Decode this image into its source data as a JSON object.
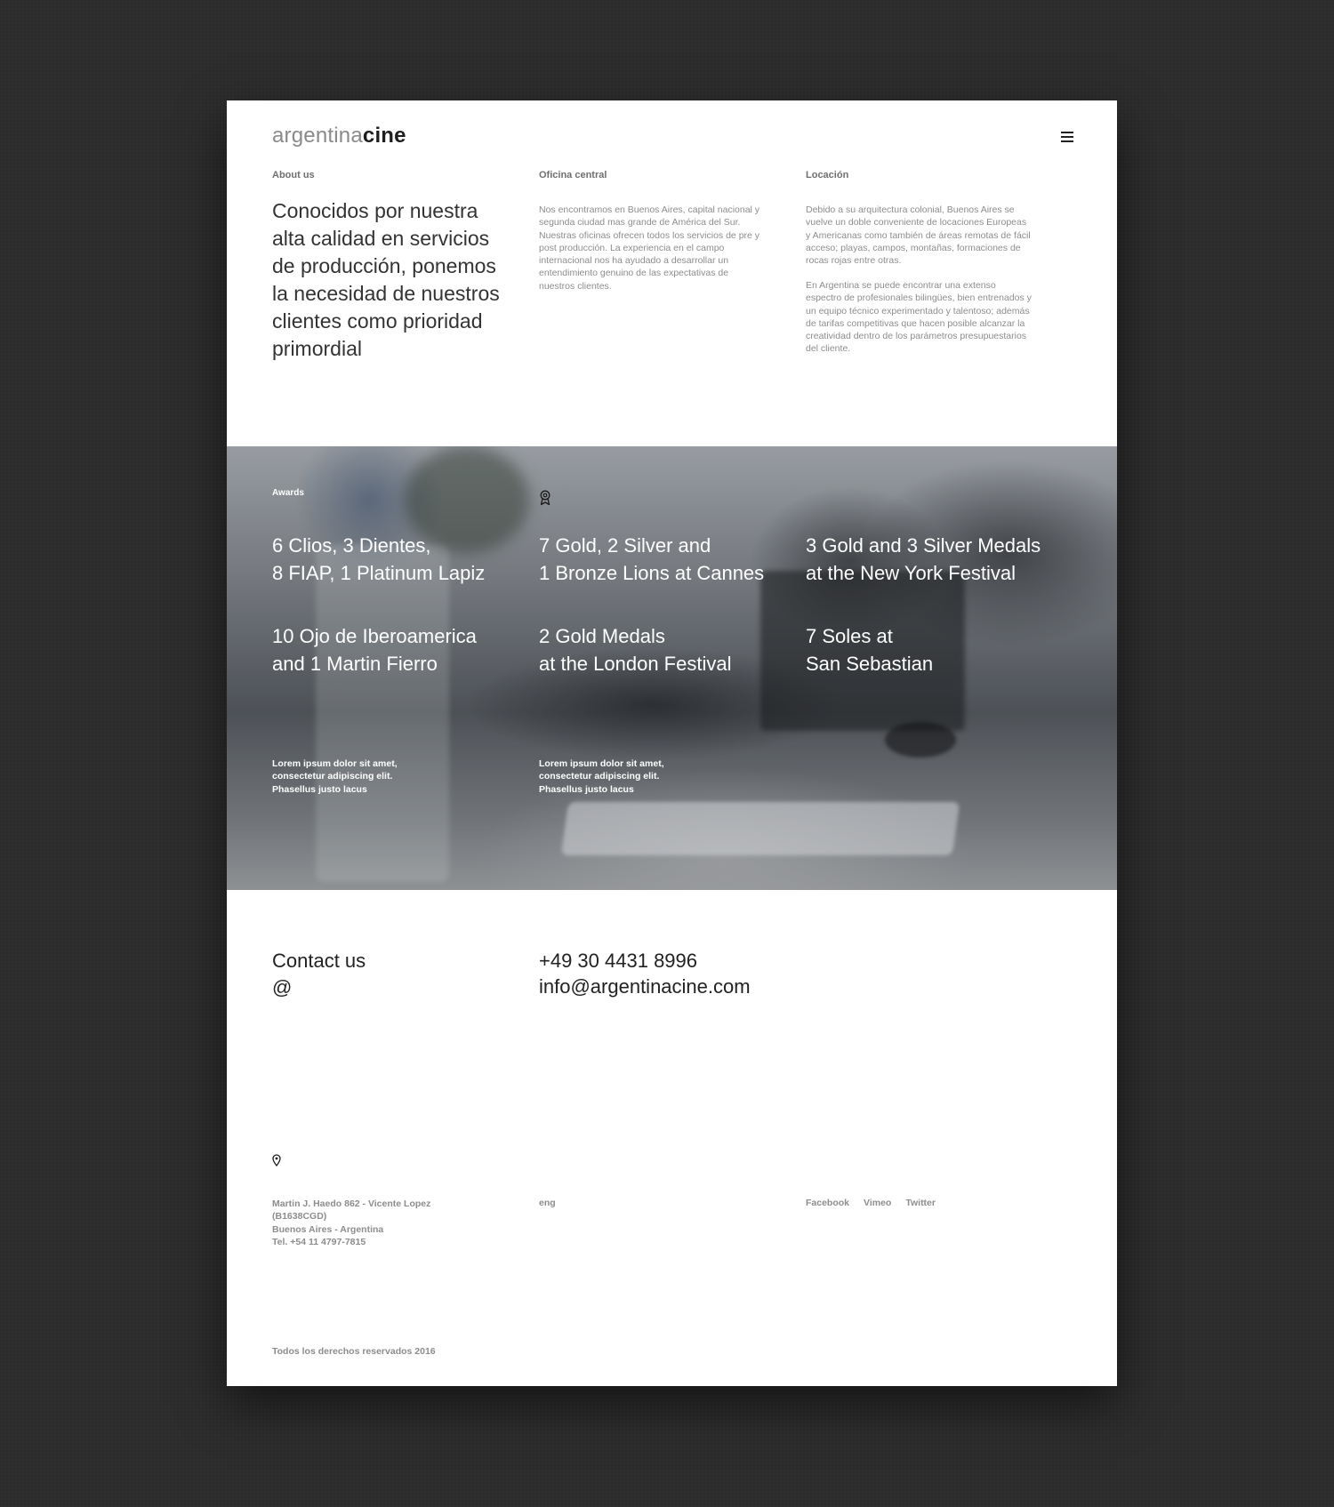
{
  "header": {
    "logo_light": "argentina",
    "logo_bold": "cine",
    "menu_icon": "hamburger-menu-icon"
  },
  "about": {
    "label": "About us",
    "text": "Conocidos por nuestra alta calidad en servicios de producción, ponemos la necesidad de nuestros clientes como prioridad primordial"
  },
  "office": {
    "label": "Oficina central",
    "text": "Nos encontramos en Buenos Aires, capital nacional y segunda ciudad mas grande de América del Sur. Nuestras oficinas ofrecen todos los servicios de pre y post producción. La experiencia en el campo internacional nos ha ayudado a desarrollar un entendimiento genuino de las expectativas de nuestros clientes."
  },
  "location": {
    "label": "Locación",
    "text1": "Debido a su arquitectura colonial, Buenos Aires se vuelve un doble conveniente de locaciones Europeas y Americanas como también de áreas remotas de fácil acceso; playas, campos, montañas, formaciones de rocas rojas entre otras.",
    "text2": "En Argentina se puede encontrar una extenso espectro de profesionales bilingües, bien entrenados y un equipo técnico experimentado y talentoso; además de tarifas competitivas que hacen posible alcanzar la creatividad dentro de los parámetros presupuestarios del cliente."
  },
  "awards": {
    "label": "Awards",
    "icon": "award-ribbon-icon",
    "items": [
      "6 Clios, 3 Dientes,\n8 FIAP, 1 Platinum Lapiz",
      "7 Gold, 2 Silver and\n1 Bronze Lions at Cannes",
      "3 Gold and 3 Silver Medals\nat the New York Festival",
      "10 Ojo de Iberoamerica\nand 1 Martin Fierro",
      "2 Gold Medals\nat the London Festival",
      "7 Soles at\nSan Sebastian"
    ],
    "lorem_1": "Lorem ipsum dolor sit amet, consectetur adipiscing elit. Phasellus justo lacus",
    "lorem_2": "Lorem ipsum dolor sit amet, consectetur adipiscing elit. Phasellus justo lacus"
  },
  "contact": {
    "title": "Contact us",
    "at": "@",
    "phone": "+49 30 4431 8996",
    "email": "info@argentinacine.com",
    "pin_icon": "location-pin-icon"
  },
  "footer": {
    "address_1": "Martin J. Haedo 862 - Vicente Lopez",
    "address_2": "(B1638CGD)",
    "address_3": "Buenos Aires - Argentina",
    "address_4": "Tel. +54 11 4797-7815",
    "lang": "eng",
    "social": [
      "Facebook",
      "Vimeo",
      "Twitter"
    ],
    "copyright": "Todos los derechos reservados 2016"
  }
}
